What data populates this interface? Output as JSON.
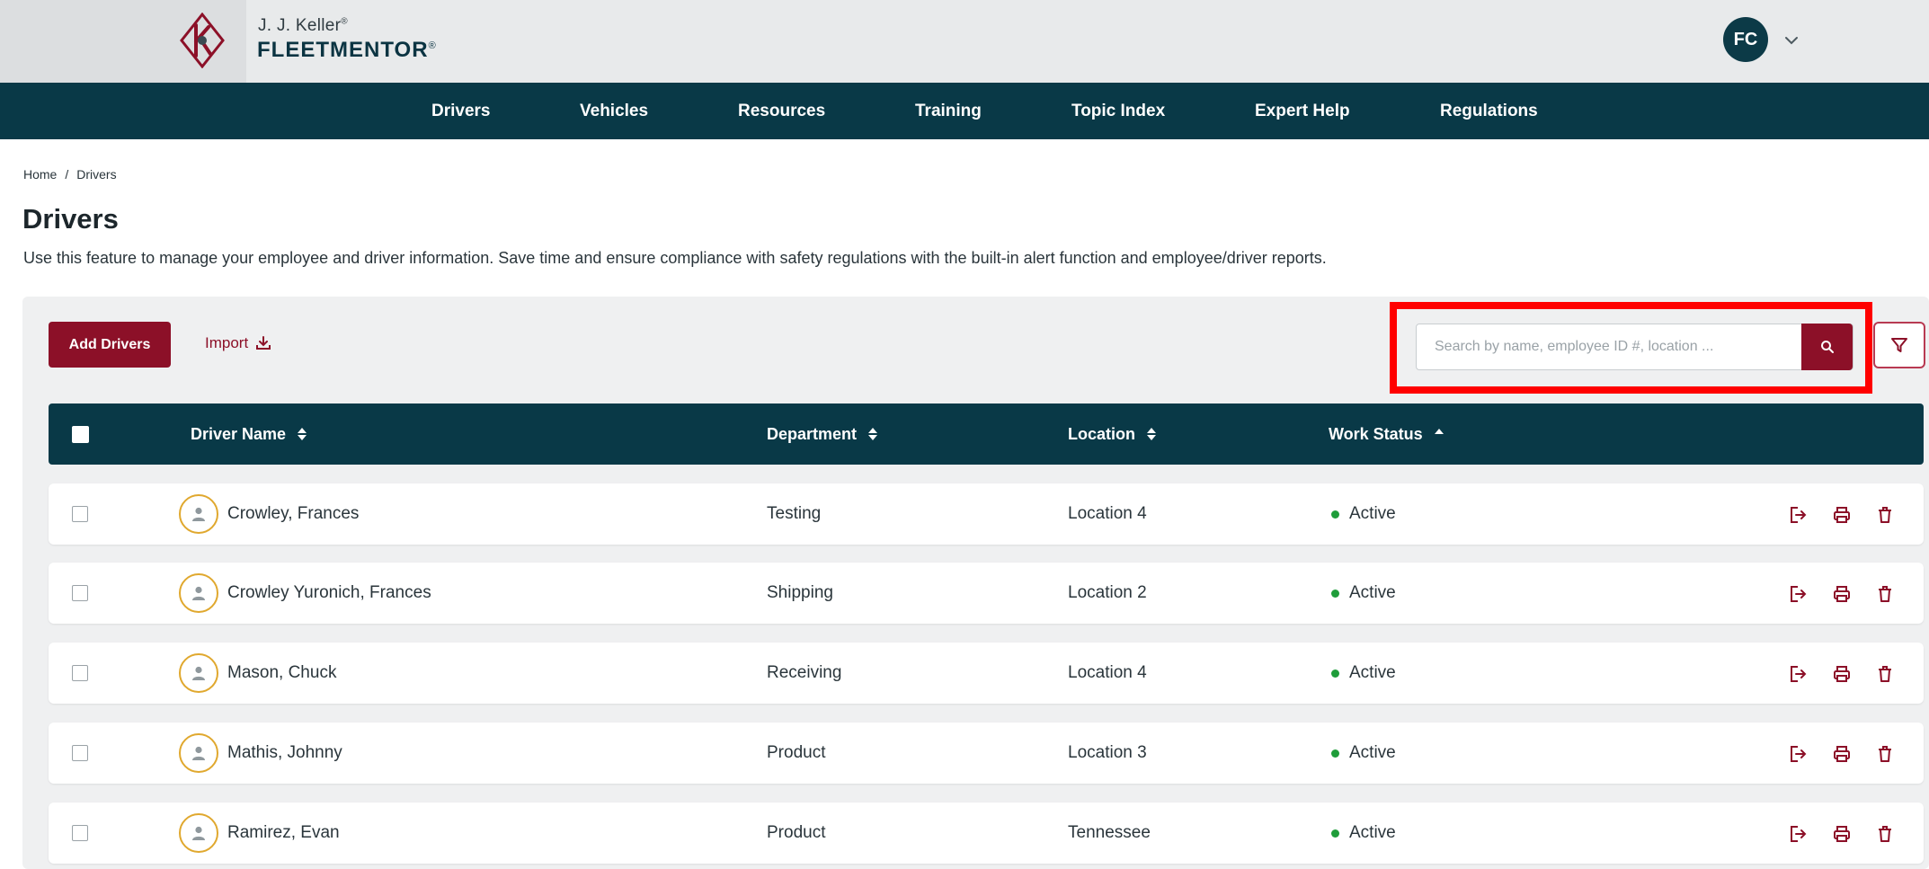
{
  "brand": {
    "company": "J. J. Keller",
    "company_mark": "®",
    "product": "FLEETMENTOR",
    "product_mark": "®",
    "logo_icon": "jj-keller-k-logo-icon"
  },
  "user": {
    "initials": "FC",
    "menu_icon": "chevron-down-icon"
  },
  "nav": {
    "items": [
      {
        "label": "Drivers"
      },
      {
        "label": "Vehicles"
      },
      {
        "label": "Resources"
      },
      {
        "label": "Training"
      },
      {
        "label": "Topic Index"
      },
      {
        "label": "Expert Help"
      },
      {
        "label": "Regulations"
      }
    ]
  },
  "breadcrumb": {
    "home": "Home",
    "separator": "/",
    "current": "Drivers"
  },
  "page": {
    "title": "Drivers",
    "description": "Use this feature to manage your employee and driver information. Save time and ensure compliance with safety regulations with the built-in alert function and employee/driver reports."
  },
  "toolbar": {
    "add_label": "Add Drivers",
    "import_label": "Import",
    "search_placeholder": "Search by name, employee ID #, location ...",
    "search_icon": "search-icon",
    "filter_icon": "filter-icon"
  },
  "table": {
    "headers": {
      "name": "Driver Name",
      "department": "Department",
      "location": "Location",
      "status": "Work Status"
    },
    "sort": {
      "name": "both",
      "department": "both",
      "location": "both",
      "status": "ascending"
    },
    "rows": [
      {
        "name": "Crowley, Frances",
        "department": "Testing",
        "location": "Location 4",
        "status": "Active"
      },
      {
        "name": "Crowley Yuronich, Frances",
        "department": "Shipping",
        "location": "Location 2",
        "status": "Active"
      },
      {
        "name": "Mason, Chuck",
        "department": "Receiving",
        "location": "Location 4",
        "status": "Active"
      },
      {
        "name": "Mathis, Johnny",
        "department": "Product",
        "location": "Location 3",
        "status": "Active"
      },
      {
        "name": "Ramirez, Evan",
        "department": "Product",
        "location": "Tennessee",
        "status": "Active"
      }
    ]
  },
  "colors": {
    "navy": "#093947",
    "brand_red": "#8c1028",
    "highlight": "#ff0000",
    "status_active": "#1f9d3a",
    "avatar_ring": "#e0a82e"
  }
}
